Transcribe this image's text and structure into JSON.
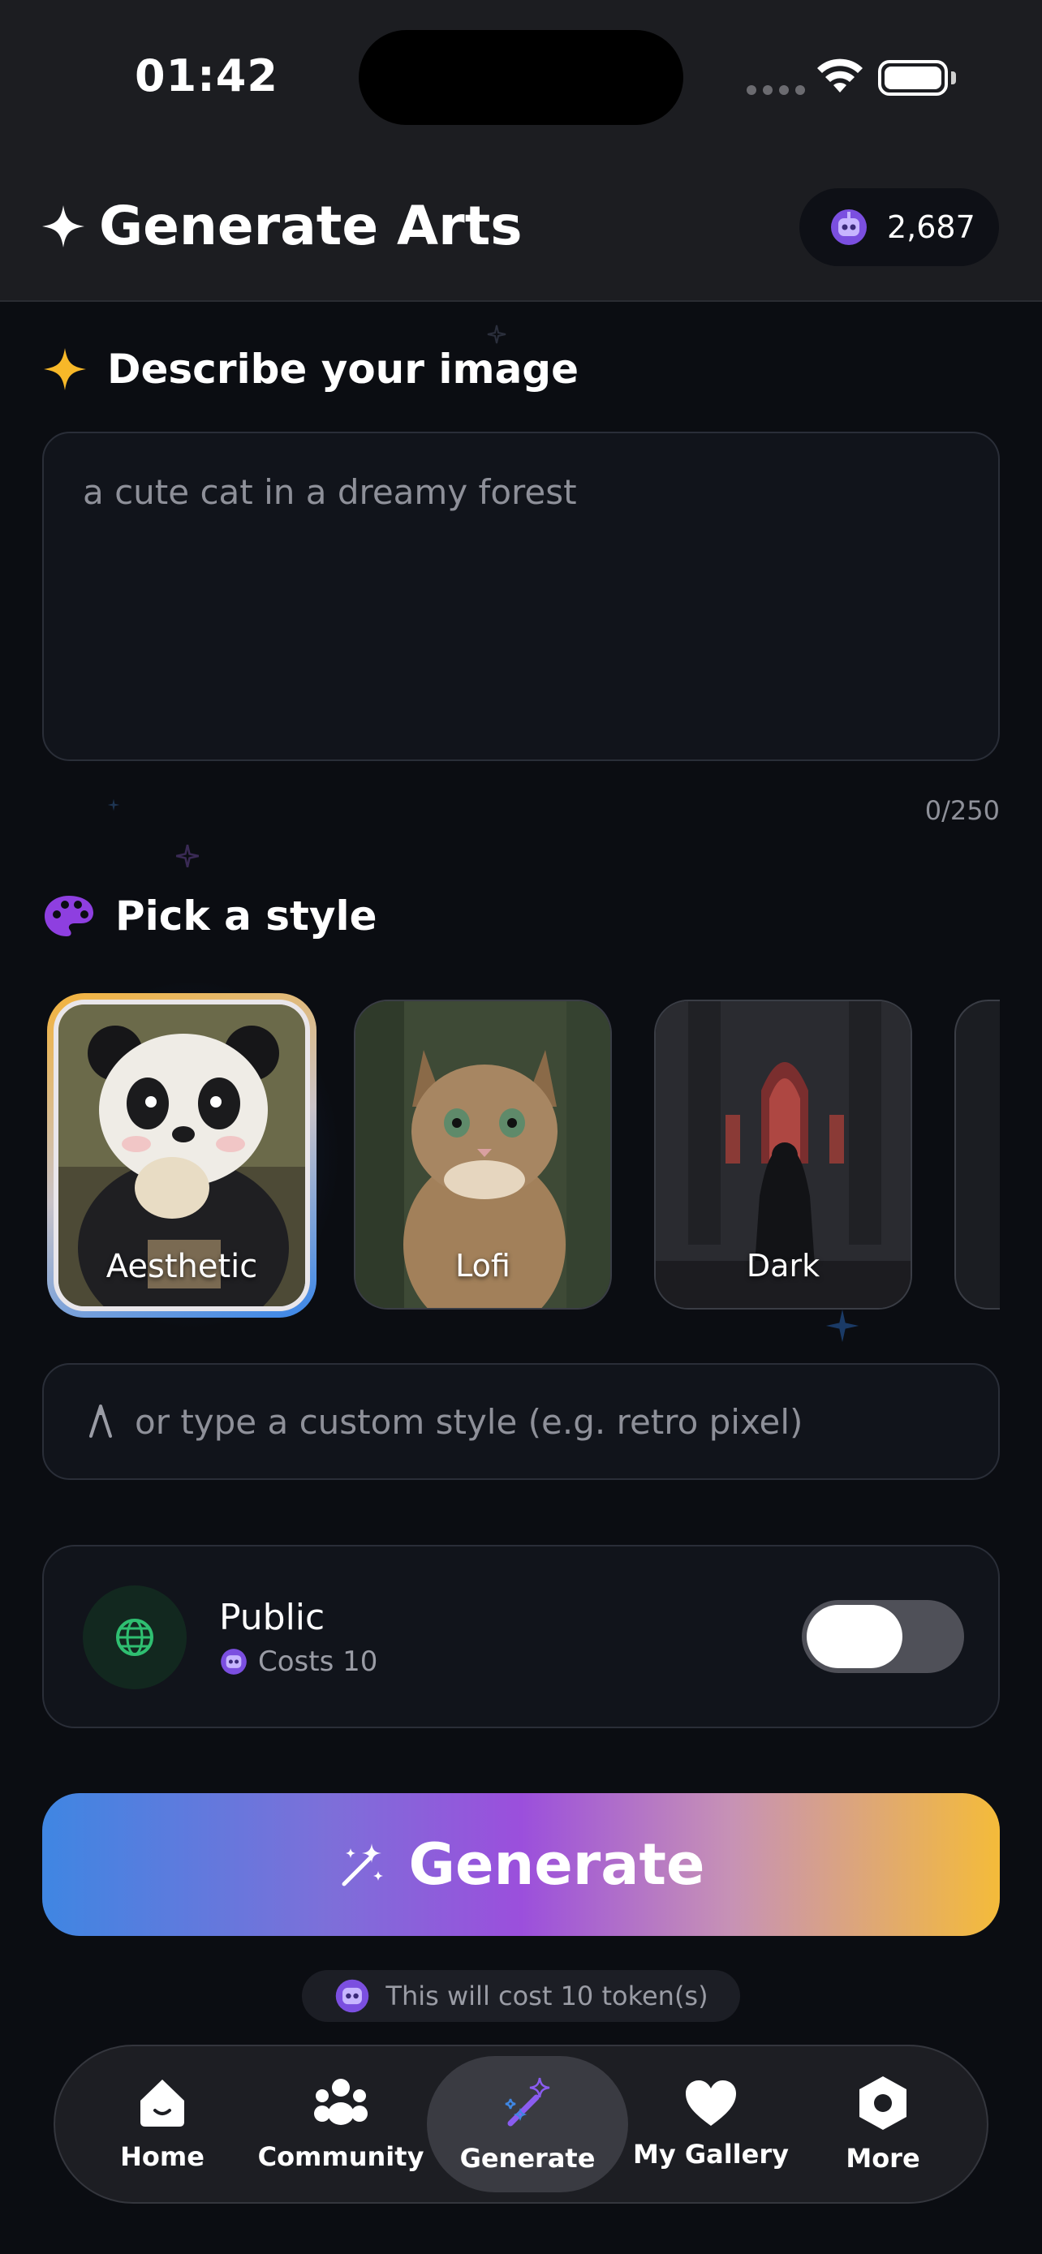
{
  "status_bar": {
    "time": "01:42"
  },
  "header": {
    "title": "Generate Arts",
    "token_count": "2,687"
  },
  "describe": {
    "title": "Describe your image",
    "placeholder": "a cute cat in a dreamy forest",
    "char_count": "0/250"
  },
  "styles": {
    "title": "Pick a style",
    "items": [
      {
        "label": "Aesthetic",
        "selected": true
      },
      {
        "label": "Lofi",
        "selected": false
      },
      {
        "label": "Dark",
        "selected": false
      }
    ],
    "custom_placeholder": "or type a custom style (e.g. retro pixel)"
  },
  "visibility": {
    "title": "Public",
    "cost": "Costs 10",
    "toggle_on": false
  },
  "generate": {
    "label": "Generate",
    "cost_note": "This will cost 10 token(s)"
  },
  "tabbar": {
    "items": [
      {
        "label": "Home",
        "icon": "home-icon"
      },
      {
        "label": "Community",
        "icon": "community-icon"
      },
      {
        "label": "Generate",
        "icon": "magic-wand-icon",
        "active": true
      },
      {
        "label": "My Gallery",
        "icon": "heart-icon"
      },
      {
        "label": "More",
        "icon": "more-icon"
      }
    ]
  },
  "colors": {
    "background": "#0b0d12",
    "accent_gold": "#f7b829",
    "accent_purple": "#9b4fdc",
    "accent_blue": "#3f86e2"
  }
}
